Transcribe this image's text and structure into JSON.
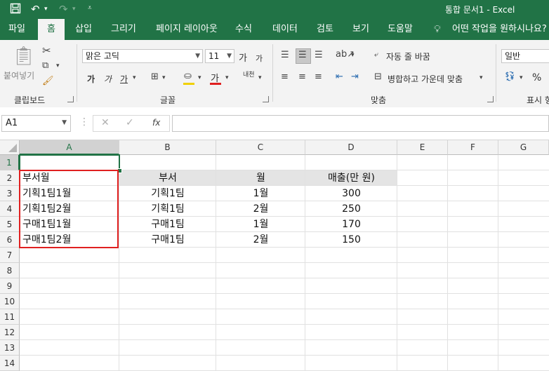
{
  "titlebar": {
    "title": "통합 문서1  -  Excel"
  },
  "tabs": [
    "파일",
    "홈",
    "삽입",
    "그리기",
    "페이지 레이아웃",
    "수식",
    "데이터",
    "검토",
    "보기",
    "도움말",
    "어떤 작업을 원하시나요?"
  ],
  "ribbon": {
    "clipboard": {
      "paste_label": "붙여넣기",
      "group_label": "클립보드"
    },
    "font": {
      "font_name": "맑은 고딕",
      "font_size": "11",
      "bold": "가",
      "italic": "가",
      "underline": "가",
      "font_color_glyph": "가",
      "phonetic": "내천",
      "grow": "가",
      "shrink": "가",
      "group_label": "글꼴"
    },
    "alignment": {
      "wrap_text": "자동 줄 바꿈",
      "merge_center": "병합하고 가운데 맞춤",
      "group_label": "맞춤"
    },
    "number": {
      "format": "일반",
      "percent": "%",
      "group_label": "표시 형"
    }
  },
  "formula_bar": {
    "name_box": "A1",
    "cancel": "✕",
    "enter": "✓",
    "fx": "fx",
    "value": ""
  },
  "grid": {
    "columns": [
      "A",
      "B",
      "C",
      "D",
      "E",
      "F",
      "G"
    ],
    "rows": [
      "1",
      "2",
      "3",
      "4",
      "5",
      "6",
      "7",
      "8",
      "9",
      "10",
      "11",
      "12",
      "13",
      "14"
    ],
    "col_a": [
      "부서월",
      "기획1팀1월",
      "기획1팀2월",
      "구매1팀1월",
      "구매1팀2월"
    ],
    "table_header": [
      "부서",
      "월",
      "매출(만 원)"
    ],
    "table_rows": [
      [
        "기획1팀",
        "1월",
        "300"
      ],
      [
        "기획1팀",
        "2월",
        "250"
      ],
      [
        "구매1팀",
        "1월",
        "170"
      ],
      [
        "구매1팀",
        "2월",
        "150"
      ]
    ]
  },
  "colors": {
    "excel_green": "#217346",
    "highlight_red": "#e02020",
    "header_band": "#e4e4e4"
  }
}
